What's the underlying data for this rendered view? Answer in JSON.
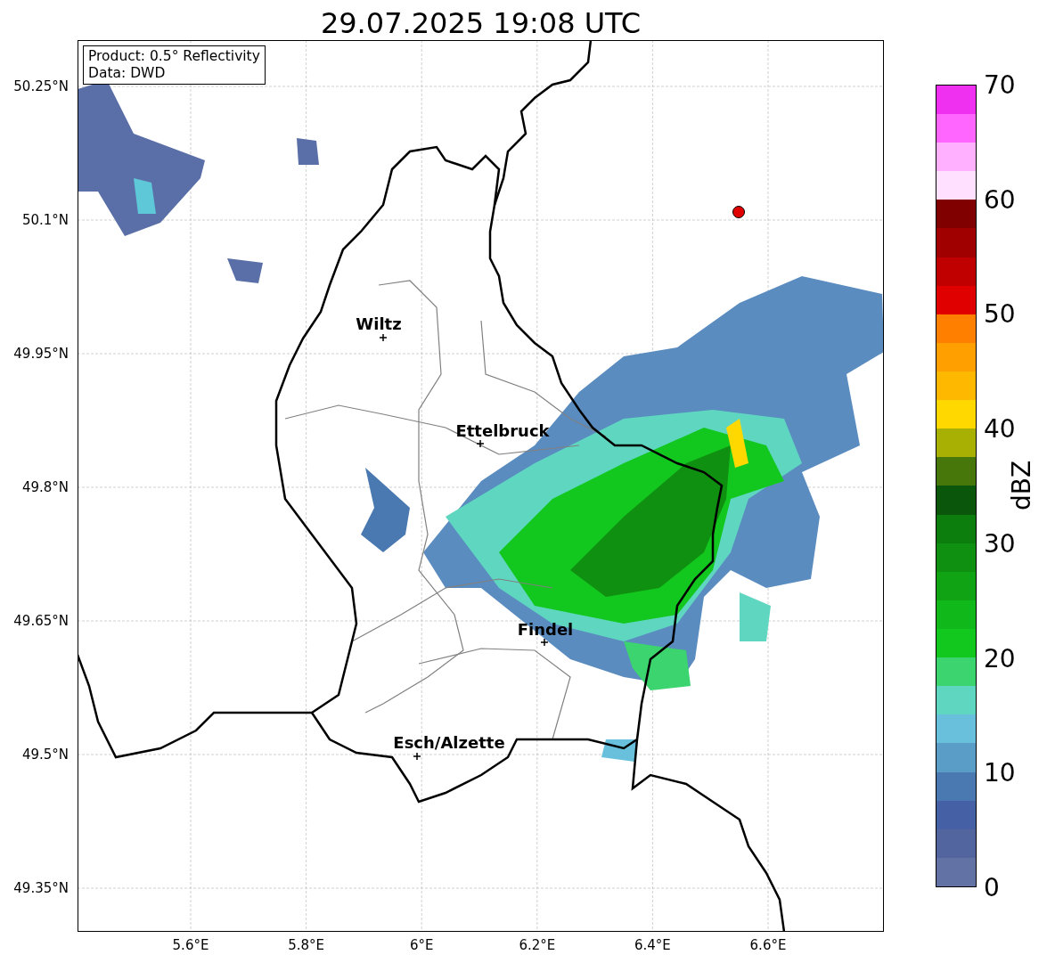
{
  "title": "29.07.2025 19:08 UTC",
  "legend": [
    "Product: 0.5° Reflectivity",
    "Data: DWD"
  ],
  "lat_ticks": [
    "50.25°N",
    "50.1°N",
    "49.95°N",
    "49.8°N",
    "49.65°N",
    "49.5°N",
    "49.35°N"
  ],
  "lon_ticks": [
    "5.6°E",
    "5.8°E",
    "6°E",
    "6.2°E",
    "6.4°E",
    "6.6°E"
  ],
  "cities": [
    {
      "name": "Wiltz"
    },
    {
      "name": "Ettelbruck"
    },
    {
      "name": "Findel"
    },
    {
      "name": "Esch/Alzette"
    }
  ],
  "colorbar": {
    "label": "dBZ",
    "ticks": [
      "70",
      "60",
      "50",
      "40",
      "30",
      "20",
      "10",
      "0"
    ],
    "segments": [
      {
        "color": "#6272a4"
      },
      {
        "color": "#53659e"
      },
      {
        "color": "#4560a5"
      },
      {
        "color": "#4a78b0"
      },
      {
        "color": "#5a9ec8"
      },
      {
        "color": "#68c0dc"
      },
      {
        "color": "#5fd6c0"
      },
      {
        "color": "#3cd46e"
      },
      {
        "color": "#12c81e"
      },
      {
        "color": "#10b81a"
      },
      {
        "color": "#10a414"
      },
      {
        "color": "#109010"
      },
      {
        "color": "#0c7e0e"
      },
      {
        "color": "#0a560a"
      },
      {
        "color": "#47760a"
      },
      {
        "color": "#a8b004"
      },
      {
        "color": "#ffd800"
      },
      {
        "color": "#ffb800"
      },
      {
        "color": "#ffa000"
      },
      {
        "color": "#ff8000"
      },
      {
        "color": "#e00000"
      },
      {
        "color": "#c00000"
      },
      {
        "color": "#a00000"
      },
      {
        "color": "#800000"
      },
      {
        "color": "#ffe0ff"
      },
      {
        "color": "#ffb0ff"
      },
      {
        "color": "#ff66ff"
      },
      {
        "color": "#f030f0"
      }
    ]
  }
}
